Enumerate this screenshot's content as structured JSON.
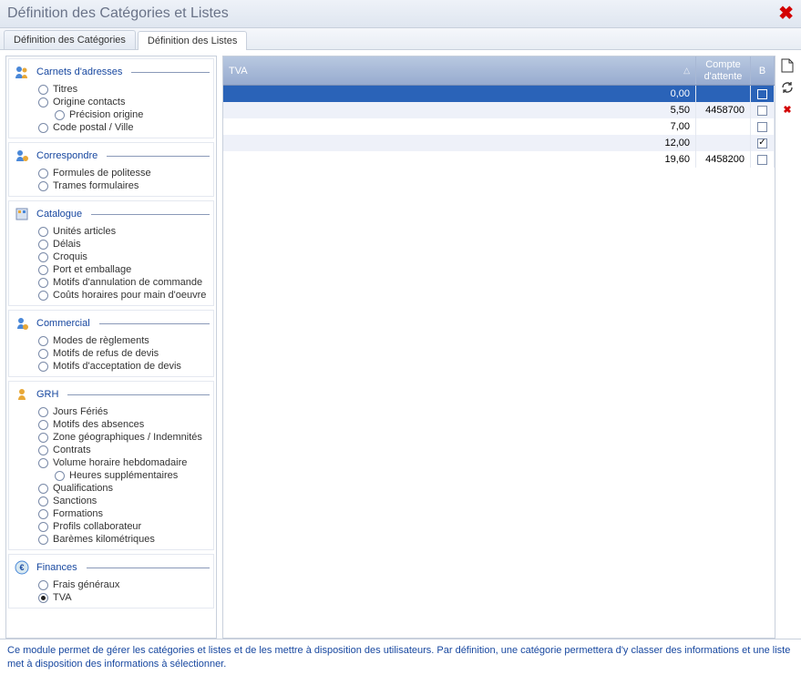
{
  "title": "Définition des Catégories et Listes",
  "tabs": [
    {
      "label": "Définition des Catégories",
      "active": false
    },
    {
      "label": "Définition des Listes",
      "active": true
    }
  ],
  "sidebar": {
    "groups": [
      {
        "title": "Carnets d'adresses",
        "icon": "people-icon",
        "items": [
          {
            "label": "Titres"
          },
          {
            "label": "Origine contacts"
          },
          {
            "label": "Précision origine",
            "sub": true
          },
          {
            "label": "Code postal / Ville"
          }
        ]
      },
      {
        "title": "Correspondre",
        "icon": "correspond-icon",
        "items": [
          {
            "label": "Formules de politesse"
          },
          {
            "label": "Trames formulaires"
          }
        ]
      },
      {
        "title": "Catalogue",
        "icon": "catalog-icon",
        "items": [
          {
            "label": "Unités articles"
          },
          {
            "label": "Délais"
          },
          {
            "label": "Croquis"
          },
          {
            "label": "Port et emballage"
          },
          {
            "label": "Motifs d'annulation de commande"
          },
          {
            "label": "Coûts horaires pour main d'oeuvre"
          }
        ]
      },
      {
        "title": "Commercial",
        "icon": "commercial-icon",
        "items": [
          {
            "label": "Modes de règlements"
          },
          {
            "label": "Motifs de refus de devis"
          },
          {
            "label": "Motifs d'acceptation de devis"
          }
        ]
      },
      {
        "title": "GRH",
        "icon": "grh-icon",
        "items": [
          {
            "label": "Jours Fériés"
          },
          {
            "label": "Motifs des absences"
          },
          {
            "label": "Zone géographiques / Indemnités"
          },
          {
            "label": "Contrats"
          },
          {
            "label": "Volume horaire hebdomadaire"
          },
          {
            "label": "Heures supplémentaires",
            "sub": true
          },
          {
            "label": "Qualifications"
          },
          {
            "label": "Sanctions"
          },
          {
            "label": "Formations"
          },
          {
            "label": "Profils collaborateur"
          },
          {
            "label": "Barèmes kilométriques"
          }
        ]
      },
      {
        "title": "Finances",
        "icon": "finances-icon",
        "items": [
          {
            "label": "Frais généraux"
          },
          {
            "label": "TVA",
            "selected": true
          }
        ]
      }
    ]
  },
  "table": {
    "columns": {
      "tva": "TVA",
      "compte": "Compte d'attente",
      "b": "B"
    },
    "rows": [
      {
        "tva": "0,00",
        "compte": "",
        "b": false,
        "selected": true
      },
      {
        "tva": "5,50",
        "compte": "4458700",
        "b": false
      },
      {
        "tva": "7,00",
        "compte": "",
        "b": false
      },
      {
        "tva": "12,00",
        "compte": "",
        "b": true
      },
      {
        "tva": "19,60",
        "compte": "4458200",
        "b": false
      }
    ]
  },
  "footer": "Ce module permet de gérer les catégories et listes et de les mettre à disposition des utilisateurs. Par définition, une catégorie permettera d'y classer des informations et une liste met à disposition des informations à sélectionner."
}
